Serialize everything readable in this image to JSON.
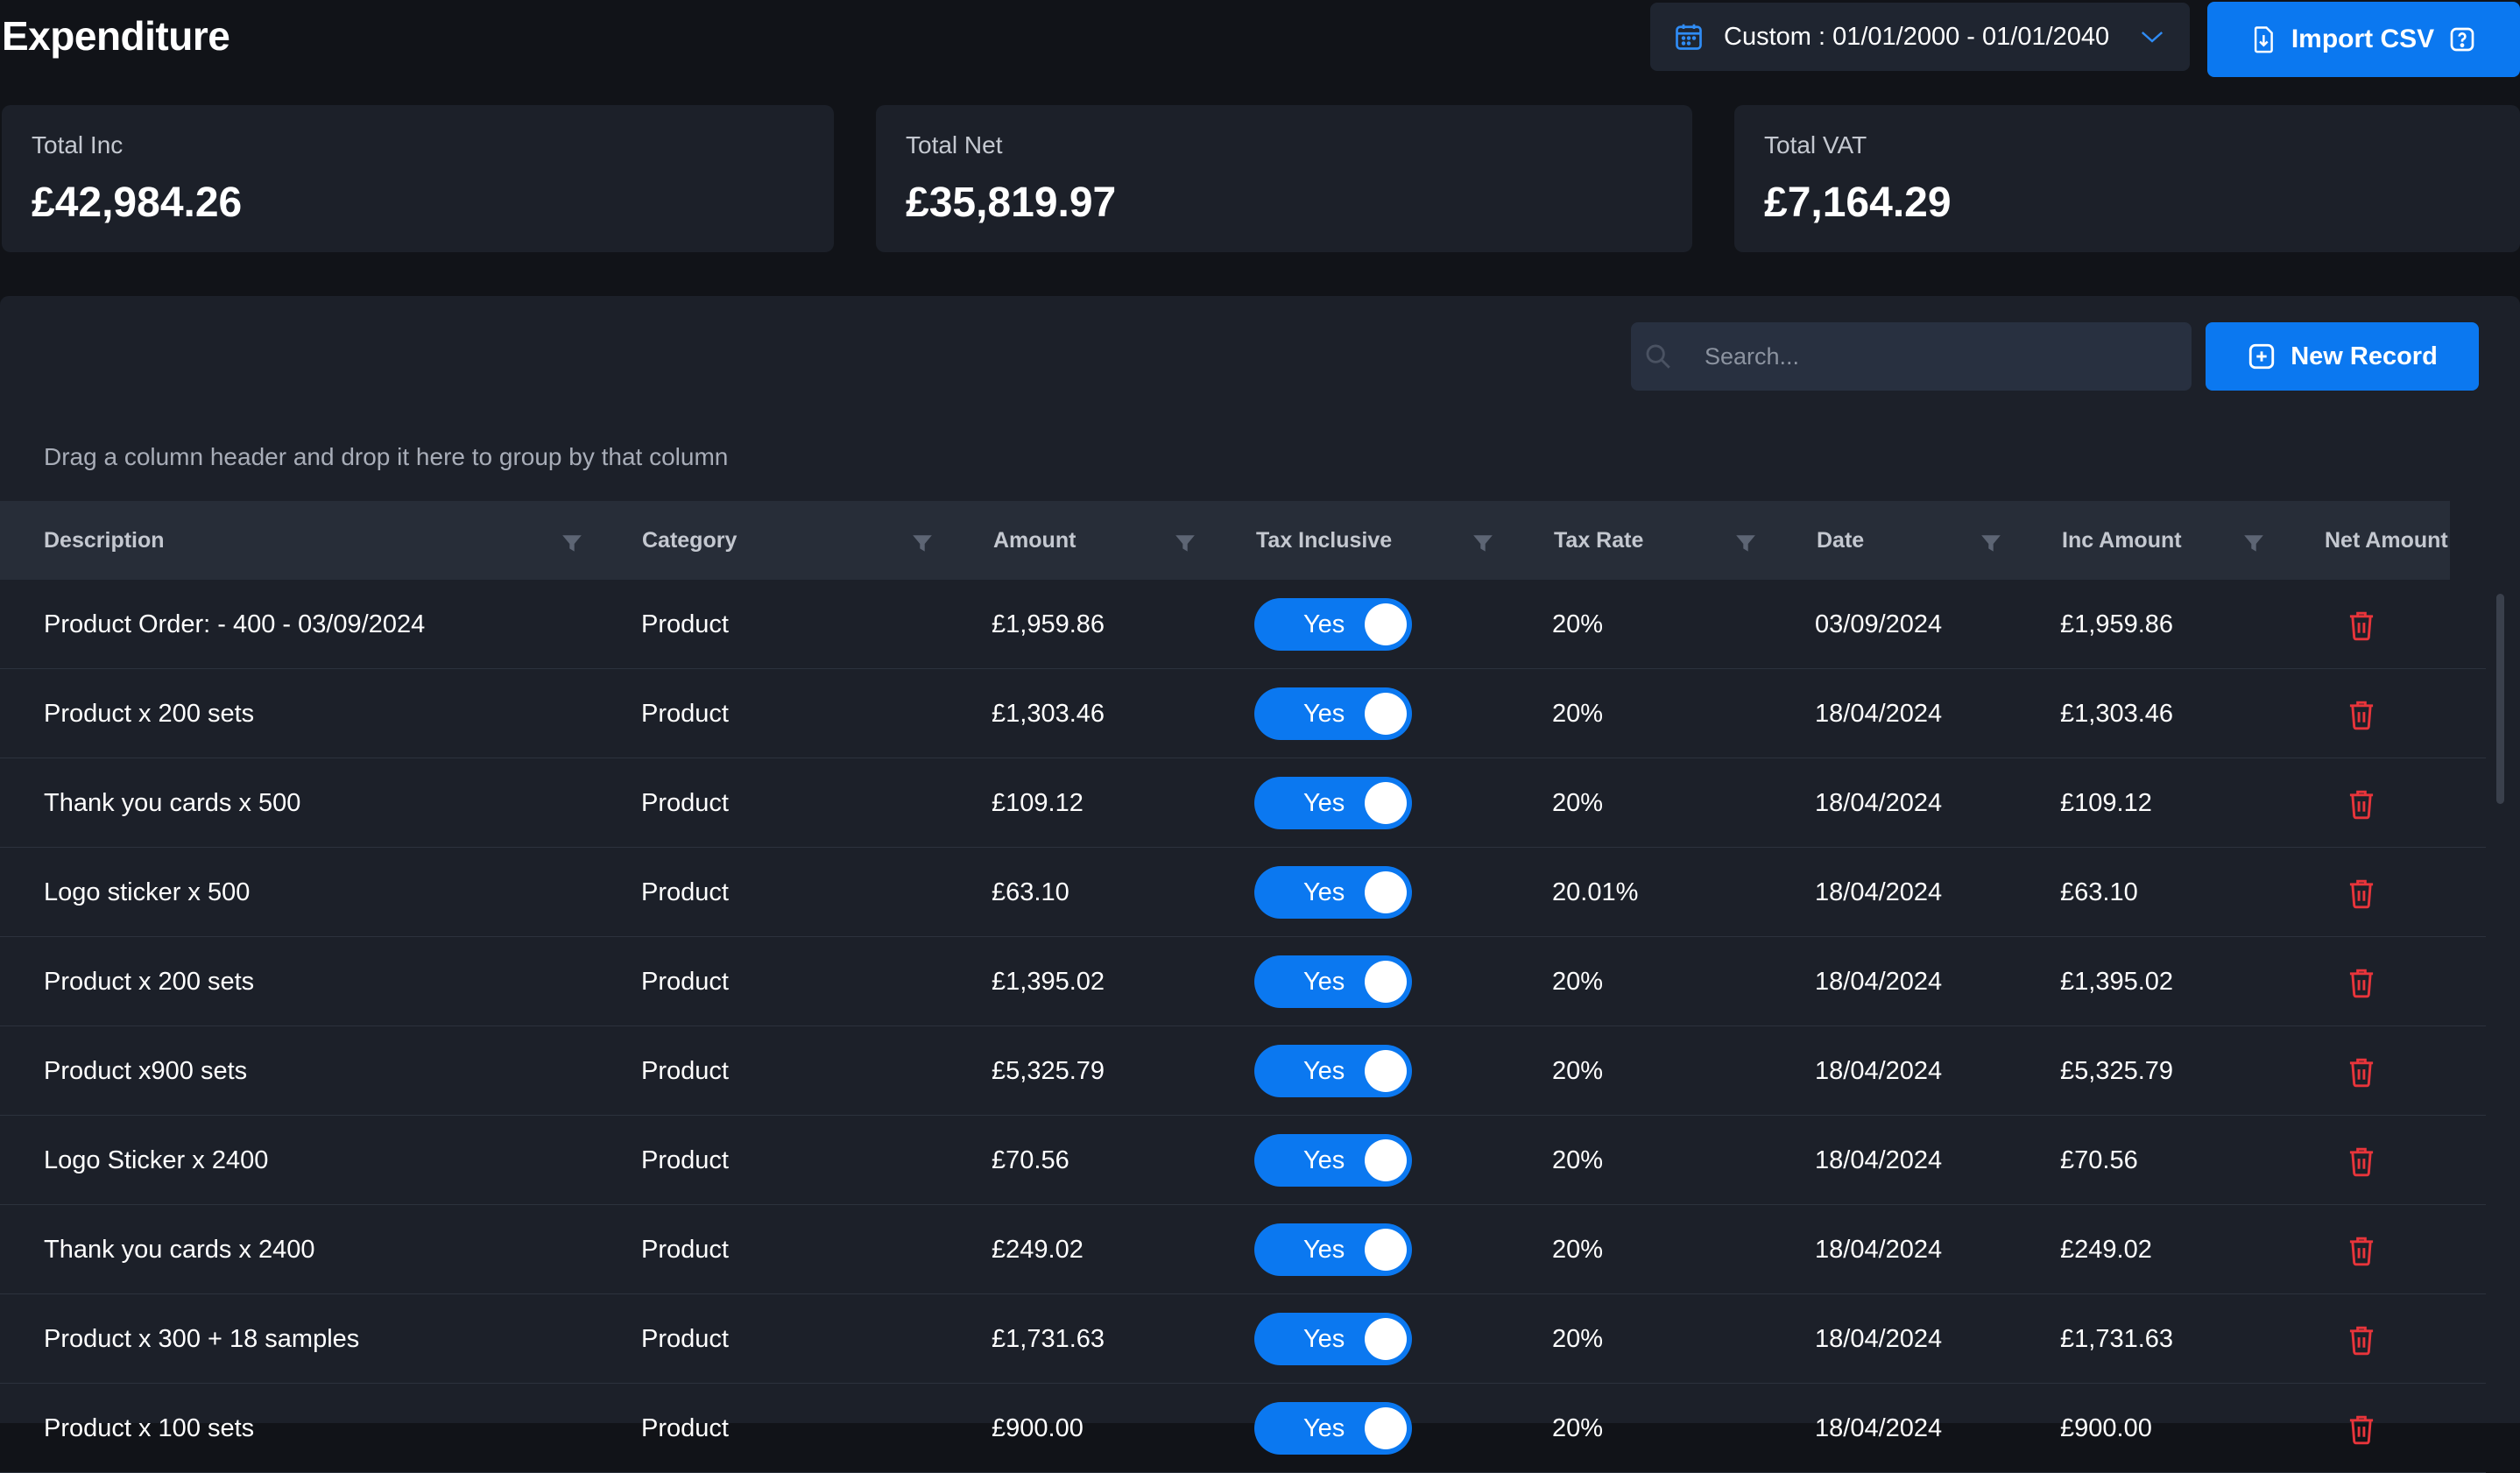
{
  "header": {
    "title": "Expenditure",
    "date_range": "Custom : 01/01/2000 - 01/01/2040",
    "import_label": "Import CSV"
  },
  "summary": [
    {
      "label": "Total Inc",
      "value": "£42,984.26"
    },
    {
      "label": "Total Net",
      "value": "£35,819.97"
    },
    {
      "label": "Total VAT",
      "value": "£7,164.29"
    }
  ],
  "toolbar": {
    "search_placeholder": "Search...",
    "new_record_label": "New Record",
    "group_hint": "Drag a column header and drop it here to group by that column"
  },
  "columns": [
    "Description",
    "Category",
    "Amount",
    "Tax Inclusive",
    "Tax Rate",
    "Date",
    "Inc Amount",
    "Net Amount"
  ],
  "rows": [
    {
      "description": "Product Order: - 400 - 03/09/2024",
      "category": "Product",
      "amount": "£1,959.86",
      "tax_inclusive": "Yes",
      "tax_rate": "20%",
      "date": "03/09/2024",
      "inc_amount": "£1,959.86"
    },
    {
      "description": "Product x 200 sets",
      "category": "Product",
      "amount": "£1,303.46",
      "tax_inclusive": "Yes",
      "tax_rate": "20%",
      "date": "18/04/2024",
      "inc_amount": "£1,303.46"
    },
    {
      "description": "Thank you cards x 500",
      "category": "Product",
      "amount": "£109.12",
      "tax_inclusive": "Yes",
      "tax_rate": "20%",
      "date": "18/04/2024",
      "inc_amount": "£109.12"
    },
    {
      "description": "Logo sticker x 500",
      "category": "Product",
      "amount": "£63.10",
      "tax_inclusive": "Yes",
      "tax_rate": "20.01%",
      "date": "18/04/2024",
      "inc_amount": "£63.10"
    },
    {
      "description": "Product x 200 sets",
      "category": "Product",
      "amount": "£1,395.02",
      "tax_inclusive": "Yes",
      "tax_rate": "20%",
      "date": "18/04/2024",
      "inc_amount": "£1,395.02"
    },
    {
      "description": "Product x900 sets",
      "category": "Product",
      "amount": "£5,325.79",
      "tax_inclusive": "Yes",
      "tax_rate": "20%",
      "date": "18/04/2024",
      "inc_amount": "£5,325.79"
    },
    {
      "description": "Logo Sticker x 2400",
      "category": "Product",
      "amount": "£70.56",
      "tax_inclusive": "Yes",
      "tax_rate": "20%",
      "date": "18/04/2024",
      "inc_amount": "£70.56"
    },
    {
      "description": "Thank you cards x 2400",
      "category": "Product",
      "amount": "£249.02",
      "tax_inclusive": "Yes",
      "tax_rate": "20%",
      "date": "18/04/2024",
      "inc_amount": "£249.02"
    },
    {
      "description": "Product x 300 + 18 samples",
      "category": "Product",
      "amount": "£1,731.63",
      "tax_inclusive": "Yes",
      "tax_rate": "20%",
      "date": "18/04/2024",
      "inc_amount": "£1,731.63"
    },
    {
      "description": "Product x 100 sets",
      "category": "Product",
      "amount": "£900.00",
      "tax_inclusive": "Yes",
      "tax_rate": "20%",
      "date": "18/04/2024",
      "inc_amount": "£900.00"
    }
  ],
  "colors": {
    "accent": "#0b78f0",
    "background": "#111318",
    "panel": "#1c2029",
    "delete": "#e8353b"
  },
  "icons": {
    "date": "calendar-icon",
    "import": "file-import-icon",
    "help": "help-icon",
    "search": "search-icon",
    "new": "plus-square-icon",
    "filter": "filter-funnel-icon",
    "delete": "trash-icon"
  }
}
